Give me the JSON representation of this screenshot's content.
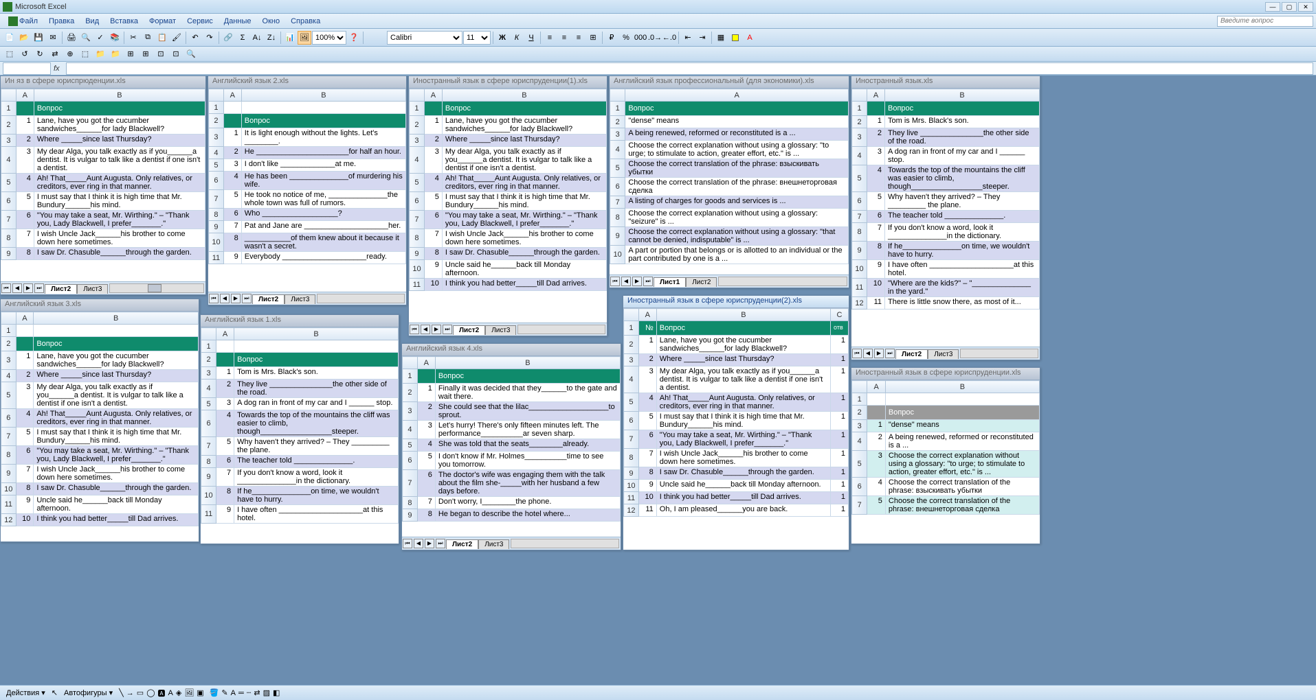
{
  "app_title": "Microsoft Excel",
  "menu": [
    "Файл",
    "Правка",
    "Вид",
    "Вставка",
    "Формат",
    "Сервис",
    "Данные",
    "Окно",
    "Справка"
  ],
  "question_placeholder": "Введите вопрос",
  "font_name": "Calibri",
  "font_size": "11",
  "zoom": "100%",
  "statusbar": {
    "actions": "Действия ▾",
    "autoshapes": "Автофигуры ▾"
  },
  "sheet_tabs": {
    "active": "Лист2",
    "inactive": "Лист3"
  },
  "column_headers": {
    "A": "A",
    "B": "B",
    "num_col": "№",
    "vopros": "Вопрос",
    "otv": "отв"
  },
  "windows": {
    "w1": {
      "title": "Ин яз в сфере юриспрюденции.xls",
      "active_tab": "Лист2",
      "inactive_tab": "Лист3",
      "header": "Вопрос",
      "rows": [
        [
          "1",
          "Lane, have you got the cucumber sandwiches______for lady Blackwell?"
        ],
        [
          "2",
          "Where _____since last Thursday?"
        ],
        [
          "3",
          "My dear Alga, you talk exactly as if you______a dentist. It is vulgar to talk like a dentist if one isn't a dentist."
        ],
        [
          "4",
          "Ah! That_____Aunt Augusta. Only relatives, or creditors, ever ring in that manner."
        ],
        [
          "5",
          "I must say that I think it is high time that Mr. Bundury______his mind."
        ],
        [
          "6",
          "\"You may take a seat, Mr. Wirthing.\" – \"Thank you, Lady Blackwell, I prefer_______.\""
        ],
        [
          "7",
          "I wish Uncle Jack______his brother to come down here sometimes."
        ],
        [
          "8",
          "I saw Dr. Chasuble______through the garden."
        ]
      ]
    },
    "w2": {
      "title": "Английский язык 2.xls",
      "active_tab": "Лист2",
      "inactive_tab": "Лист3",
      "header": "Вопрос",
      "rows": [
        [
          "1",
          "It is light enough without the lights. Let's ________."
        ],
        [
          "2",
          "He ______________________for half an hour."
        ],
        [
          "3",
          "I don't like _____________at me."
        ],
        [
          "4",
          "He has been ______________of murdering his wife."
        ],
        [
          "5",
          "He took no notice of me, ______________the whole town was full of rumors."
        ],
        [
          "6",
          "Who __________________?"
        ],
        [
          "7",
          "Pat and Jane are ____________________her."
        ],
        [
          "8",
          "___________of them knew about it because it wasn't a secret."
        ],
        [
          "9",
          "Everybody ____________________ready."
        ]
      ]
    },
    "w3": {
      "title": "Иностранный язык в сфере юриспруденции(1).xls",
      "active_tab": "Лист2",
      "inactive_tab": "Лист3",
      "header": "Вопрос",
      "rows": [
        [
          "1",
          "Lane, have you got the cucumber sandwiches______for lady Blackwell?"
        ],
        [
          "2",
          "Where _____since last Thursday?"
        ],
        [
          "3",
          "My dear Alga, you talk exactly as if you______a dentist. It is vulgar to talk like a dentist if one isn't a dentist."
        ],
        [
          "4",
          "Ah! That_____Aunt Augusta. Only relatives, or creditors, ever ring in that manner."
        ],
        [
          "5",
          "I must say that I think it is high time that Mr. Bundury______his mind."
        ],
        [
          "6",
          "\"You may take a seat, Mr. Wirthing.\" – \"Thank you, Lady Blackwell, I prefer_______.\""
        ],
        [
          "7",
          "I wish Uncle Jack______his brother to come down here sometimes."
        ],
        [
          "8",
          "I saw Dr. Chasuble______through the garden."
        ],
        [
          "9",
          "Uncle said he______back till Monday afternoon."
        ],
        [
          "10",
          "I think you had better_____till Dad arrives."
        ]
      ]
    },
    "w4": {
      "title": "Английский язык профессиональный (для экономики).xls",
      "active_tab": "Лист1",
      "inactive_tab": "Лист2",
      "header": "Вопрос",
      "rows": [
        [
          "1",
          "\"dense\" means"
        ],
        [
          "2",
          "A being renewed, reformed or reconstituted is a ..."
        ],
        [
          "3",
          "Choose the correct explanation without using a glossary: \"to urge; to stimulate to action, greater effort, etc.\" is ..."
        ],
        [
          "4",
          "Choose the correct translation of the phrase: взыскивать убытки"
        ],
        [
          "5",
          "Choose the correct translation of the phrase: внешнеторговая сделка"
        ],
        [
          "6",
          "A listing of charges for goods and services is ..."
        ],
        [
          "7",
          "Choose the correct explanation without using a glossary: \"seizure\" is ..."
        ],
        [
          "8",
          "Choose the correct explanation without using a glossary: \"that cannot be denied, indisputable\" is ..."
        ],
        [
          "9",
          "A part or portion that belongs or is allotted to an individual or the part contributed by one is a ..."
        ]
      ],
      "row_nums": [
        "1",
        "2",
        "3",
        "4",
        "5",
        "6",
        "7",
        "8",
        "9",
        "10"
      ]
    },
    "w5": {
      "title": "Иностранный язык.xls",
      "active_tab": "Лист2",
      "inactive_tab": "Лист3",
      "header": "Вопрос",
      "rows": [
        [
          "1",
          "Tom is Mrs. Black's son."
        ],
        [
          "2",
          "They live _______________the other side of the road."
        ],
        [
          "3",
          "A dog ran in front of my car and I ______ stop."
        ],
        [
          "4",
          "Towards the top of the mountains the cliff was easier to climb, though_________________steeper."
        ],
        [
          "5",
          "Why haven't they arrived? – They _________ the plane."
        ],
        [
          "6",
          "The teacher told ______________."
        ],
        [
          "7",
          "If you don't know a word, look it ______________in the dictionary."
        ],
        [
          "8",
          "If he______________on time, we wouldn't have to hurry."
        ],
        [
          "9",
          "I have often ____________________at this hotel."
        ],
        [
          "10",
          "\"Where are the kids?\" – \"______________ in the yard.\""
        ],
        [
          "11",
          "There is little snow there, as most of it..."
        ]
      ]
    },
    "w6": {
      "title": "Английский язык 3.xls",
      "active_tab": "Лист2",
      "inactive_tab": "Лист3",
      "header": "Вопрос",
      "rows": [
        [
          "1",
          "Lane, have you got the cucumber sandwiches______for lady Blackwell?"
        ],
        [
          "2",
          "Where _____since last Thursday?"
        ],
        [
          "3",
          "My dear Alga, you talk exactly as if you______a dentist. It is vulgar to talk like a dentist if one isn't a dentist."
        ],
        [
          "4",
          "Ah! That_____Aunt Augusta. Only relatives, or creditors, ever ring in that manner."
        ],
        [
          "5",
          "I must say that I think it is high time that Mr. Bundury______his mind."
        ],
        [
          "6",
          "\"You may take a seat, Mr. Wirthing.\" – \"Thank you, Lady Blackwell, I prefer_______.\""
        ],
        [
          "7",
          "I wish Uncle Jack______his brother to come down here sometimes."
        ],
        [
          "8",
          "I saw Dr. Chasuble______through the garden."
        ],
        [
          "9",
          "Uncle said he______back till Monday afternoon."
        ],
        [
          "10",
          "I think you had better_____till Dad arrives."
        ]
      ]
    },
    "w7": {
      "title": "Английский язык 1.xls",
      "active_tab": "Лист2",
      "inactive_tab": "Лист3",
      "header": "Вопрос",
      "rows": [
        [
          "1",
          "Tom is Mrs. Black's son."
        ],
        [
          "2",
          "They live _______________the other side of the road."
        ],
        [
          "3",
          "A dog ran in front of my car and I ______ stop."
        ],
        [
          "4",
          "Towards the top of the mountains the cliff was easier to climb, though_________________steeper."
        ],
        [
          "5",
          "Why haven't they arrived? – They _________ the plane."
        ],
        [
          "6",
          "The teacher told ______________."
        ],
        [
          "7",
          "If you don't know a word, look it ______________in the dictionary."
        ],
        [
          "8",
          "If he______________on time, we wouldn't have to hurry."
        ],
        [
          "9",
          "I have often ____________________at this hotel."
        ]
      ]
    },
    "w8": {
      "title": "Английский язык 4.xls",
      "active_tab": "Лист2",
      "inactive_tab": "Лист3",
      "header": "Вопрос",
      "rows": [
        [
          "1",
          "Finally it was decided that they______to the gate and wait there."
        ],
        [
          "2",
          "She could see that the lilac___________________to sprout."
        ],
        [
          "3",
          "Let's hurry! There's only fifteen minutes left. The performance__________ar seven sharp."
        ],
        [
          "4",
          "She was told that the seats________already."
        ],
        [
          "5",
          "I don't know if Mr. Holmes__________time to see you tomorrow."
        ],
        [
          "6",
          "The doctor's wife was engaging them with the talk about the film she-_____with her husband a few days before."
        ],
        [
          "7",
          "Don't worry, I________the phone."
        ],
        [
          "8",
          "He began to describe the hotel where..."
        ]
      ]
    },
    "w9": {
      "title": "Иностранный язык в сфере юриспруденции(2).xls",
      "active_tab": "Лист2",
      "inactive_tab": "Лист3",
      "header": "Вопрос",
      "other_header_label": "№",
      "otv_label": "отв",
      "rows": [
        [
          "1",
          "Lane, have you got the cucumber sandwiches______for lady Blackwell?",
          "1"
        ],
        [
          "2",
          "Where _____since last Thursday?",
          "1"
        ],
        [
          "3",
          "My dear Alga, you talk exactly as if you______a dentist. It is vulgar to talk like a dentist if one isn't a dentist.",
          "1"
        ],
        [
          "4",
          "Ah! That_____Aunt Augusta. Only relatives, or creditors, ever ring in that manner.",
          "1"
        ],
        [
          "5",
          "I must say that I think it is high time that Mr. Bundury______his mind.",
          "1"
        ],
        [
          "6",
          "\"You may take a seat, Mr. Wirthing.\" – \"Thank you, Lady Blackwell, I prefer_______.\"",
          "1"
        ],
        [
          "7",
          "I wish Uncle Jack______his brother to come down here sometimes.",
          "1"
        ],
        [
          "8",
          "I saw Dr. Chasuble______through the garden.",
          "1"
        ],
        [
          "9",
          "Uncle said he______back till Monday afternoon.",
          "1"
        ],
        [
          "10",
          "I think you had better_____till Dad arrives.",
          "1"
        ],
        [
          "11",
          "Oh, I am pleased______you are back.",
          "1"
        ]
      ]
    },
    "w10": {
      "title": "Иностранный язык в сфере юриспруденции.xls",
      "header": "Вопрос",
      "rows": [
        [
          "1",
          "\"dense\" means"
        ],
        [
          "2",
          "A being renewed, reformed or reconstituted is a ..."
        ],
        [
          "3",
          "Choose the correct explanation without using a glossary: \"to urge; to stimulate to action, greater effort, etc.\" is ..."
        ],
        [
          "4",
          "Choose the correct translation of the phrase: взыскивать убытки"
        ],
        [
          "5",
          "Choose the correct translation of the phrase: внешнеторговая сделка"
        ]
      ]
    }
  }
}
